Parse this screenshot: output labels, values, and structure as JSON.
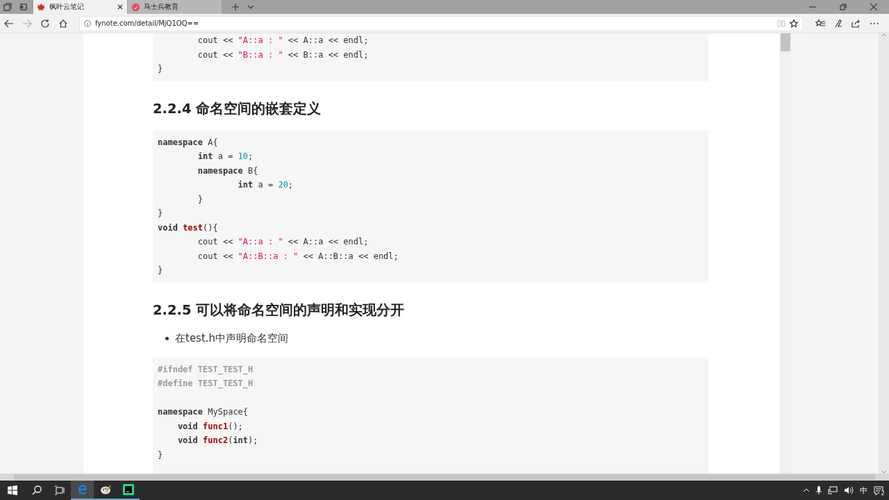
{
  "browser": {
    "tabs": [
      {
        "title": "枫叶云笔记",
        "selected": true
      },
      {
        "title": "马士兵教育",
        "selected": false
      }
    ],
    "address": "fynote.com/detail/MjQ1OQ=="
  },
  "content": [
    {
      "kind": "code",
      "lines": [
        [
          {
            "kind": "plain",
            "text": "        cout << "
          },
          {
            "kind": "str",
            "text": "\"A::a : \""
          },
          {
            "kind": "plain",
            "text": " << A::a << endl;"
          }
        ],
        [
          {
            "kind": "plain",
            "text": "        cout << "
          },
          {
            "kind": "str",
            "text": "\"B::a : \""
          },
          {
            "kind": "plain",
            "text": " << B::a << endl;"
          }
        ],
        [
          {
            "kind": "plain",
            "text": "}"
          }
        ]
      ]
    },
    {
      "kind": "heading",
      "text": "2.2.4 命名空间的嵌套定义"
    },
    {
      "kind": "code",
      "lines": [
        [
          {
            "kind": "kw",
            "text": "namespace"
          },
          {
            "kind": "plain",
            "text": " A{"
          }
        ],
        [
          {
            "kind": "kw",
            "text": "        int"
          },
          {
            "kind": "plain",
            "text": " a = "
          },
          {
            "kind": "num",
            "text": "10"
          },
          {
            "kind": "plain",
            "text": ";"
          }
        ],
        [
          {
            "kind": "kw",
            "text": "        namespace"
          },
          {
            "kind": "plain",
            "text": " B{"
          }
        ],
        [
          {
            "kind": "kw",
            "text": "                int"
          },
          {
            "kind": "plain",
            "text": " a = "
          },
          {
            "kind": "num",
            "text": "20"
          },
          {
            "kind": "plain",
            "text": ";"
          }
        ],
        [
          {
            "kind": "plain",
            "text": "        }"
          }
        ],
        [
          {
            "kind": "plain",
            "text": "}"
          }
        ],
        [
          {
            "kind": "kw",
            "text": "void "
          },
          {
            "kind": "fn",
            "text": "test"
          },
          {
            "kind": "plain",
            "text": "(){"
          }
        ],
        [
          {
            "kind": "plain",
            "text": "        cout << "
          },
          {
            "kind": "str",
            "text": "\"A::a : \""
          },
          {
            "kind": "plain",
            "text": " << A::a << endl;"
          }
        ],
        [
          {
            "kind": "plain",
            "text": "        cout << "
          },
          {
            "kind": "str",
            "text": "\"A::B::a : \""
          },
          {
            "kind": "plain",
            "text": " << A::B::a << endl;"
          }
        ],
        [
          {
            "kind": "plain",
            "text": "}"
          }
        ]
      ]
    },
    {
      "kind": "heading",
      "text": "2.2.5 可以将命名空间的声明和实现分开"
    },
    {
      "kind": "bullet",
      "text": "在test.h中声明命名空间"
    },
    {
      "kind": "code",
      "lines": [
        [
          {
            "kind": "pre",
            "text": "#ifndef TEST_TEST_H"
          }
        ],
        [
          {
            "kind": "pre",
            "text": "#define TEST_TEST_H"
          }
        ],
        [
          {
            "kind": "kw",
            "text": "namespace"
          },
          {
            "kind": "plain",
            "text": " MySpace{"
          }
        ],
        [
          {
            "kind": "kw",
            "text": "    void "
          },
          {
            "kind": "fn",
            "text": "func1"
          },
          {
            "kind": "plain",
            "text": "();"
          }
        ],
        [
          {
            "kind": "kw",
            "text": "    void "
          },
          {
            "kind": "fn",
            "text": "func2"
          },
          {
            "kind": "plain",
            "text": "("
          },
          {
            "kind": "kw",
            "text": "int"
          },
          {
            "kind": "plain",
            "text": ");"
          }
        ],
        [
          {
            "kind": "plain",
            "text": "}"
          }
        ]
      ]
    }
  ],
  "tray": {
    "ime": "中",
    "notifications": "2"
  }
}
